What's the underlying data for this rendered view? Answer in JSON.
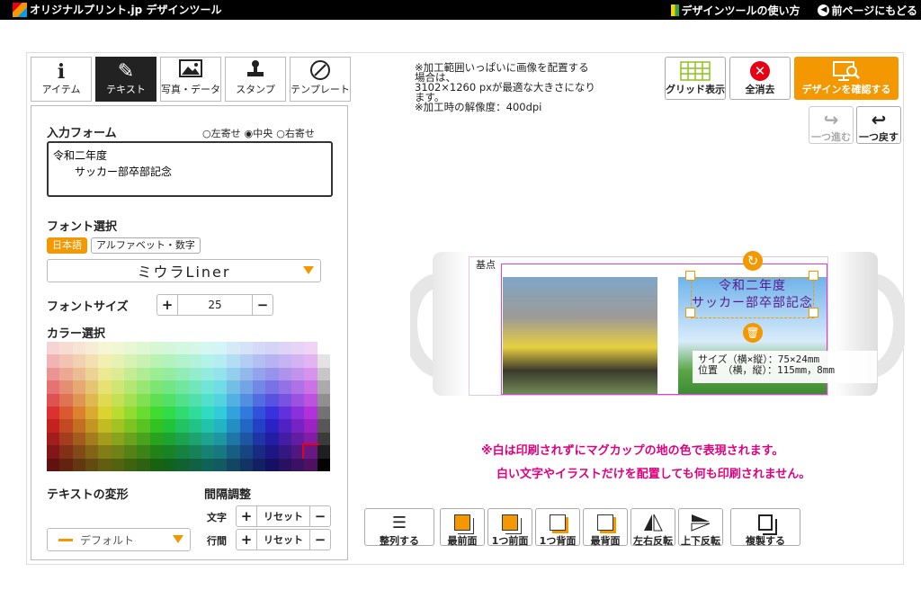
{
  "header": {
    "logo_text": "オリジナルプリント.jp デザインツール",
    "help_link": "デザインツールの使い方",
    "back_link": "前ページにもどる"
  },
  "tabs": [
    {
      "label": "アイテム",
      "icon": "info-icon"
    },
    {
      "label": "テキスト",
      "icon": "pen-icon"
    },
    {
      "label": "写真・データ",
      "icon": "image-icon"
    },
    {
      "label": "スタンプ",
      "icon": "stamp-icon"
    },
    {
      "label": "テンプレート",
      "icon": "template-icon"
    }
  ],
  "text_panel": {
    "input_title": "入力フォーム",
    "align_options": [
      "○左寄せ",
      "◉中央",
      "○右寄せ"
    ],
    "input_value": "令和二年度\n　　サッカー部卒部記念",
    "font_title": "フォント選択",
    "font_tabs": [
      "日本語",
      "アルファベット・数字"
    ],
    "font_selected": "ミウラLiner",
    "size_title": "フォントサイズ",
    "size_value": "25",
    "color_title": "カラー選択",
    "transform_title": "テキストの変形",
    "transform_value": "デフォルト",
    "spacing_title": "間隔調整",
    "spacing_char_label": "文字",
    "spacing_line_label": "行間",
    "reset_label": "リセット",
    "plus": "+",
    "minus": "−"
  },
  "notice": [
    "※加工範囲いっぱいに画像を配置する",
    "場合は、",
    "3102×1260 pxが最適な大きさになり",
    "ます。",
    "※加工時の解像度：400dpi"
  ],
  "toolbar_top": {
    "grid": "グリッド表示",
    "clear": "全消去",
    "confirm": "デザインを確認する",
    "redo": "一つ進む",
    "undo": "一つ戻す"
  },
  "canvas": {
    "base_label": "基点",
    "mug_text_line1": "令和二年度",
    "mug_text_line2": "サッカー部卒部記念",
    "tooltip_size": "サイズ（横×縦）：75×24mm",
    "tooltip_pos": "位置　（横，縦）：115mm，8mm"
  },
  "warnings": [
    "※白は印刷されずにマグカップの地の色で表現されます。",
    "白い文字やイラストだけを配置しても何も印刷されません。"
  ],
  "toolbar_bottom": [
    "整列する",
    "最前面",
    "1つ前面",
    "1つ背面",
    "最背面",
    "左右反転",
    "上下反転",
    "複製する"
  ],
  "colors": {
    "accent": "#f39800",
    "magenta": "#e0007f"
  }
}
